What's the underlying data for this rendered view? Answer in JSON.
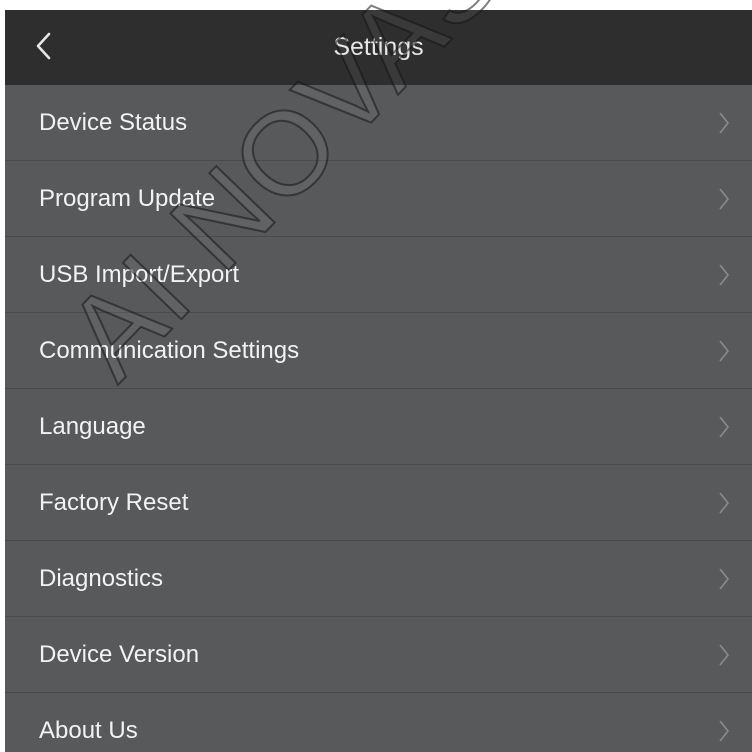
{
  "header": {
    "title": "Settings",
    "back_icon": "chevron-left-icon"
  },
  "menu": {
    "items": [
      {
        "label": "Device Status",
        "icon": "chevron-right-icon"
      },
      {
        "label": "Program Update",
        "icon": "chevron-right-icon"
      },
      {
        "label": "USB Import/Export",
        "icon": "chevron-right-icon"
      },
      {
        "label": "Communication Settings",
        "icon": "chevron-right-icon"
      },
      {
        "label": "Language",
        "icon": "chevron-right-icon"
      },
      {
        "label": "Factory Reset",
        "icon": "chevron-right-icon"
      },
      {
        "label": "Diagnostics",
        "icon": "chevron-right-icon"
      },
      {
        "label": "Device Version",
        "icon": "chevron-right-icon"
      },
      {
        "label": "About Us",
        "icon": "chevron-right-icon"
      }
    ]
  },
  "watermark": {
    "text": "AI NOVASTAR TECH"
  },
  "colors": {
    "header_bg": "#2e2e2e",
    "list_bg": "#58595b",
    "divider": "#4a4b4d",
    "text": "#f2f2f2",
    "chevron": "#8a8b8d"
  }
}
